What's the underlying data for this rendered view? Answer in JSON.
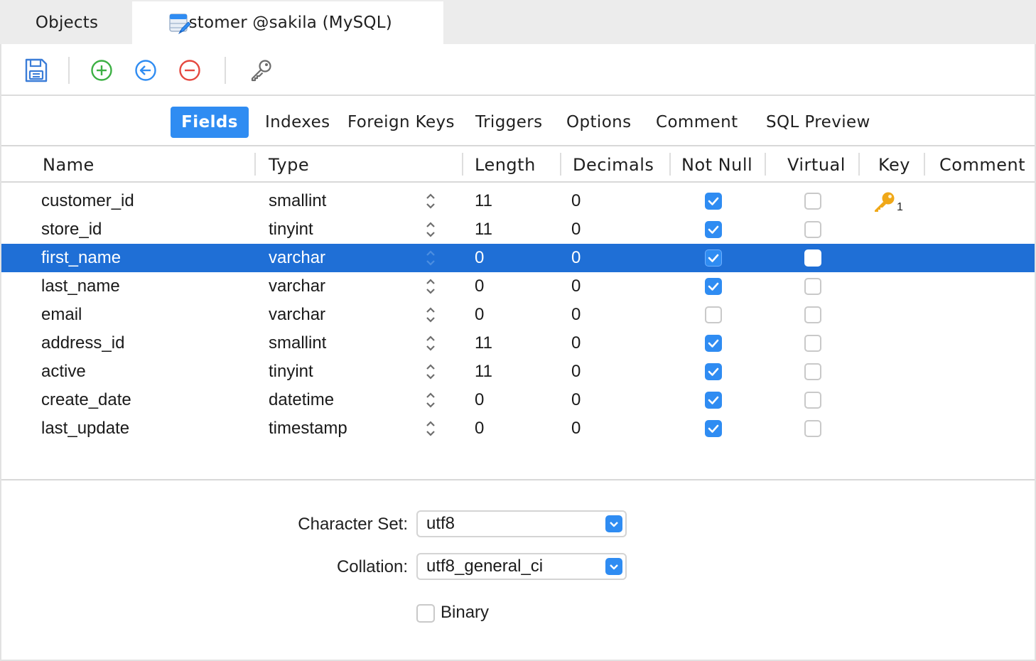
{
  "tabs": {
    "objects_label": "Objects",
    "customer_label": "customer @sakila (MySQL)"
  },
  "toolbar": {
    "save_icon": "save-icon",
    "add_icon": "add-field-icon",
    "insert_icon": "insert-field-icon",
    "delete_icon": "delete-field-icon",
    "key_icon": "primary-key-icon"
  },
  "subtabs": [
    "Fields",
    "Indexes",
    "Foreign Keys",
    "Triggers",
    "Options",
    "Comment",
    "SQL Preview"
  ],
  "columns": [
    "Name",
    "Type",
    "Length",
    "Decimals",
    "Not Null",
    "Virtual",
    "Key",
    "Comment"
  ],
  "rows": [
    {
      "name": "customer_id",
      "type": "smallint",
      "length": "11",
      "decimals": "0",
      "not_null": true,
      "virtual": false,
      "key": "1"
    },
    {
      "name": "store_id",
      "type": "tinyint",
      "length": "11",
      "decimals": "0",
      "not_null": true,
      "virtual": false,
      "key": ""
    },
    {
      "name": "first_name",
      "type": "varchar",
      "length": "0",
      "decimals": "0",
      "not_null": true,
      "virtual": false,
      "key": "",
      "selected": true
    },
    {
      "name": "last_name",
      "type": "varchar",
      "length": "0",
      "decimals": "0",
      "not_null": true,
      "virtual": false,
      "key": ""
    },
    {
      "name": "email",
      "type": "varchar",
      "length": "0",
      "decimals": "0",
      "not_null": false,
      "virtual": false,
      "key": ""
    },
    {
      "name": "address_id",
      "type": "smallint",
      "length": "11",
      "decimals": "0",
      "not_null": true,
      "virtual": false,
      "key": ""
    },
    {
      "name": "active",
      "type": "tinyint",
      "length": "11",
      "decimals": "0",
      "not_null": true,
      "virtual": false,
      "key": ""
    },
    {
      "name": "create_date",
      "type": "datetime",
      "length": "0",
      "decimals": "0",
      "not_null": true,
      "virtual": false,
      "key": ""
    },
    {
      "name": "last_update",
      "type": "timestamp",
      "length": "0",
      "decimals": "0",
      "not_null": true,
      "virtual": false,
      "key": ""
    }
  ],
  "field_props": {
    "charset_label": "Character Set:",
    "charset_value": "utf8",
    "collation_label": "Collation:",
    "collation_value": "utf8_general_ci",
    "binary_label": "Binary",
    "binary_checked": false
  },
  "colors": {
    "accent": "#2f8cf2",
    "selection": "#1f6fd6",
    "add_green": "#3cb043",
    "delete_red": "#e5483f",
    "key_gold": "#f0a818"
  }
}
